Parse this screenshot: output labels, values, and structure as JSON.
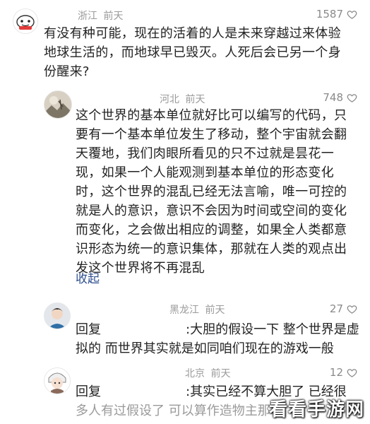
{
  "comments": [
    {
      "region": "浙江",
      "time": "前天",
      "likes": "1587",
      "lines": [
        "有没有种可能，现在的活着的人是未来穿越过来体验",
        "地球生活的，而地球早已毁灭。人死后会已另一个身",
        "份醒来?"
      ]
    },
    {
      "region": "河北",
      "time": "前天",
      "likes": "748",
      "lines": [
        "这个世界的基本单位就好比可以编写的代码，只",
        "要有一个基本单位发生了移动，整个宇宙就会翻",
        "天覆地，我们肉眼所看见的只不过就是昙花一",
        "现，如果一个人能观测到基本单位的形态变化",
        "时，这个世界的混乱已经无法言喻，唯一可控的",
        "就是人的意识，意识不会因为时间或空间的变化",
        "而变化，之会做出相应的调整，如果全人类都意",
        "识形态为统一的意识集体，那就在人类的观点出",
        "发这个世界将不再混乱"
      ],
      "collapse_label": "收起"
    },
    {
      "region": "黑龙江",
      "time": "前天",
      "likes": "27",
      "reply_label": "回复",
      "reply_first": ":大胆的假设一下 整个世界是虚",
      "reply_second": "拟的 而世界其实就是如同咱们现在的游戏一般"
    },
    {
      "region": "北京",
      "time": "前天",
      "likes": "12",
      "reply_label": "回复",
      "reply_first": ":其实已经不算大胆了 已经很",
      "reply_second": "多人有过假设了 可以算作造物主那"
    }
  ],
  "watermark": "看看手游网",
  "colors": {
    "accent_link": "#2f4f8f",
    "meta_gray": "#9a9a9a"
  },
  "icons": [
    "heart-outline-icon"
  ]
}
